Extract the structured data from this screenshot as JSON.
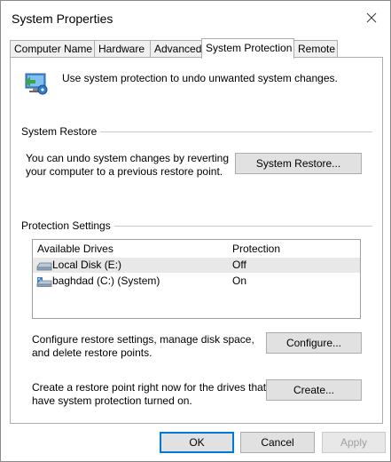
{
  "window": {
    "title": "System Properties"
  },
  "tabs": [
    {
      "label": "Computer Name"
    },
    {
      "label": "Hardware"
    },
    {
      "label": "Advanced"
    },
    {
      "label": "System Protection",
      "active": true
    },
    {
      "label": "Remote"
    }
  ],
  "intro": {
    "text": "Use system protection to undo unwanted system changes."
  },
  "system_restore": {
    "heading": "System Restore",
    "description_line1": "You can undo system changes by reverting",
    "description_line2": "your computer to a previous restore point.",
    "button": "System Restore..."
  },
  "protection": {
    "heading": "Protection Settings",
    "columns": {
      "drives": "Available Drives",
      "protection": "Protection"
    },
    "drives": [
      {
        "name": "Local Disk (E:)",
        "protection": "Off",
        "icon": "drive-icon"
      },
      {
        "name": "baghdad (C:) (System)",
        "protection": "On",
        "icon": "system-drive-icon"
      }
    ],
    "configure_text_line1": "Configure restore settings, manage disk space,",
    "configure_text_line2": "and delete restore points.",
    "configure_button": "Configure...",
    "create_text_line1": "Create a restore point right now for the drives that",
    "create_text_line2": "have system protection turned on.",
    "create_button": "Create..."
  },
  "footer": {
    "ok": "OK",
    "cancel": "Cancel",
    "apply": "Apply"
  },
  "colors": {
    "accent": "#0078d7",
    "button_bg": "#e1e1e1",
    "border": "#adadad",
    "selected_row": "#e8e8e8"
  }
}
